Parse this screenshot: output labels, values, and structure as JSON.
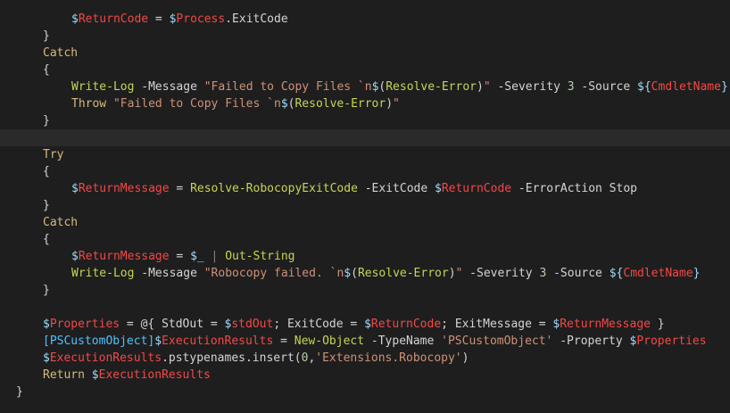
{
  "editor": {
    "lines": [
      {
        "indent": 80,
        "tokens": [
          {
            "c": "dollar",
            "t": "$"
          },
          {
            "c": "red",
            "t": "ReturnCode"
          },
          {
            "c": "op",
            "t": " = "
          },
          {
            "c": "dollar",
            "t": "$"
          },
          {
            "c": "red",
            "t": "Process"
          },
          {
            "c": "op",
            "t": ".ExitCode"
          }
        ]
      },
      {
        "indent": 48,
        "tokens": [
          {
            "c": "brace",
            "t": "}"
          }
        ]
      },
      {
        "indent": 48,
        "tokens": [
          {
            "c": "kwo",
            "t": "Catch"
          }
        ]
      },
      {
        "indent": 48,
        "tokens": [
          {
            "c": "brace",
            "t": "{"
          }
        ]
      },
      {
        "indent": 80,
        "tokens": [
          {
            "c": "fn",
            "t": "Write-Log"
          },
          {
            "c": "param",
            "t": " -Message "
          },
          {
            "c": "str",
            "t": "\"Failed to Copy Files `n"
          },
          {
            "c": "dollar",
            "t": "$"
          },
          {
            "c": "op",
            "t": "("
          },
          {
            "c": "fn",
            "t": "Resolve-Error"
          },
          {
            "c": "op",
            "t": ")"
          },
          {
            "c": "str",
            "t": "\""
          },
          {
            "c": "param",
            "t": " -Severity "
          },
          {
            "c": "num",
            "t": "3"
          },
          {
            "c": "param",
            "t": " -Source "
          },
          {
            "c": "dollar",
            "t": "${"
          },
          {
            "c": "red",
            "t": "CmdletName"
          },
          {
            "c": "dollar",
            "t": "}"
          }
        ]
      },
      {
        "indent": 80,
        "tokens": [
          {
            "c": "kwo",
            "t": "Throw"
          },
          {
            "c": "str",
            "t": " \"Failed to Copy Files `n"
          },
          {
            "c": "dollar",
            "t": "$"
          },
          {
            "c": "op",
            "t": "("
          },
          {
            "c": "fn",
            "t": "Resolve-Error"
          },
          {
            "c": "op",
            "t": ")"
          },
          {
            "c": "str",
            "t": "\""
          }
        ]
      },
      {
        "indent": 48,
        "tokens": [
          {
            "c": "brace",
            "t": "}"
          }
        ]
      },
      {
        "indent": 0,
        "current": true,
        "tokens": []
      },
      {
        "indent": 48,
        "tokens": [
          {
            "c": "kwo",
            "t": "Try"
          }
        ]
      },
      {
        "indent": 48,
        "tokens": [
          {
            "c": "brace",
            "t": "{"
          }
        ]
      },
      {
        "indent": 80,
        "tokens": [
          {
            "c": "dollar",
            "t": "$"
          },
          {
            "c": "red",
            "t": "ReturnMessage"
          },
          {
            "c": "op",
            "t": " = "
          },
          {
            "c": "fn",
            "t": "Resolve-RobocopyExitCode"
          },
          {
            "c": "param",
            "t": " -ExitCode "
          },
          {
            "c": "dollar",
            "t": "$"
          },
          {
            "c": "red",
            "t": "ReturnCode"
          },
          {
            "c": "param",
            "t": " -ErrorAction Stop"
          }
        ]
      },
      {
        "indent": 48,
        "tokens": [
          {
            "c": "brace",
            "t": "}"
          }
        ]
      },
      {
        "indent": 48,
        "tokens": [
          {
            "c": "kwo",
            "t": "Catch"
          }
        ]
      },
      {
        "indent": 48,
        "tokens": [
          {
            "c": "brace",
            "t": "{"
          }
        ]
      },
      {
        "indent": 80,
        "tokens": [
          {
            "c": "dollar",
            "t": "$"
          },
          {
            "c": "red",
            "t": "ReturnMessage"
          },
          {
            "c": "op",
            "t": " = "
          },
          {
            "c": "dollar",
            "t": "$_"
          },
          {
            "c": "gray",
            "t": " | "
          },
          {
            "c": "fn",
            "t": "Out-String"
          }
        ]
      },
      {
        "indent": 80,
        "tokens": [
          {
            "c": "fn",
            "t": "Write-Log"
          },
          {
            "c": "param",
            "t": " -Message "
          },
          {
            "c": "str",
            "t": "\"Robocopy failed. `n"
          },
          {
            "c": "dollar",
            "t": "$"
          },
          {
            "c": "op",
            "t": "("
          },
          {
            "c": "fn",
            "t": "Resolve-Error"
          },
          {
            "c": "op",
            "t": ")"
          },
          {
            "c": "str",
            "t": "\""
          },
          {
            "c": "param",
            "t": " -Severity "
          },
          {
            "c": "num",
            "t": "3"
          },
          {
            "c": "param",
            "t": " -Source "
          },
          {
            "c": "dollar",
            "t": "${"
          },
          {
            "c": "red",
            "t": "CmdletName"
          },
          {
            "c": "dollar",
            "t": "}"
          }
        ]
      },
      {
        "indent": 48,
        "tokens": [
          {
            "c": "brace",
            "t": "}"
          }
        ]
      },
      {
        "indent": 0,
        "tokens": []
      },
      {
        "indent": 48,
        "tokens": [
          {
            "c": "dollar",
            "t": "$"
          },
          {
            "c": "red",
            "t": "Properties"
          },
          {
            "c": "op",
            "t": " = @{ StdOut = "
          },
          {
            "c": "dollar",
            "t": "$"
          },
          {
            "c": "red",
            "t": "stdOut"
          },
          {
            "c": "op",
            "t": "; ExitCode = "
          },
          {
            "c": "dollar",
            "t": "$"
          },
          {
            "c": "red",
            "t": "ReturnCode"
          },
          {
            "c": "op",
            "t": "; ExitMessage = "
          },
          {
            "c": "dollar",
            "t": "$"
          },
          {
            "c": "red",
            "t": "ReturnMessage"
          },
          {
            "c": "op",
            "t": " }"
          }
        ]
      },
      {
        "indent": 48,
        "tokens": [
          {
            "c": "type",
            "t": "[PSCustomObject]"
          },
          {
            "c": "dollar",
            "t": "$"
          },
          {
            "c": "red",
            "t": "ExecutionResults"
          },
          {
            "c": "op",
            "t": " = "
          },
          {
            "c": "fn",
            "t": "New-Object"
          },
          {
            "c": "param",
            "t": " -TypeName "
          },
          {
            "c": "str",
            "t": "'PSCustomObject'"
          },
          {
            "c": "param",
            "t": " -Property "
          },
          {
            "c": "dollar",
            "t": "$"
          },
          {
            "c": "red",
            "t": "Properties"
          }
        ]
      },
      {
        "indent": 48,
        "tokens": [
          {
            "c": "dollar",
            "t": "$"
          },
          {
            "c": "red",
            "t": "ExecutionResults"
          },
          {
            "c": "op",
            "t": ".pstypenames.insert("
          },
          {
            "c": "num",
            "t": "0"
          },
          {
            "c": "op",
            "t": ","
          },
          {
            "c": "str",
            "t": "'Extensions.Robocopy'"
          },
          {
            "c": "op",
            "t": ")"
          }
        ]
      },
      {
        "indent": 48,
        "tokens": [
          {
            "c": "kwo",
            "t": "Return "
          },
          {
            "c": "dollar",
            "t": "$"
          },
          {
            "c": "red",
            "t": "ExecutionResults"
          }
        ]
      },
      {
        "indent": 18,
        "tokens": [
          {
            "c": "brace",
            "t": "}"
          }
        ]
      }
    ]
  }
}
